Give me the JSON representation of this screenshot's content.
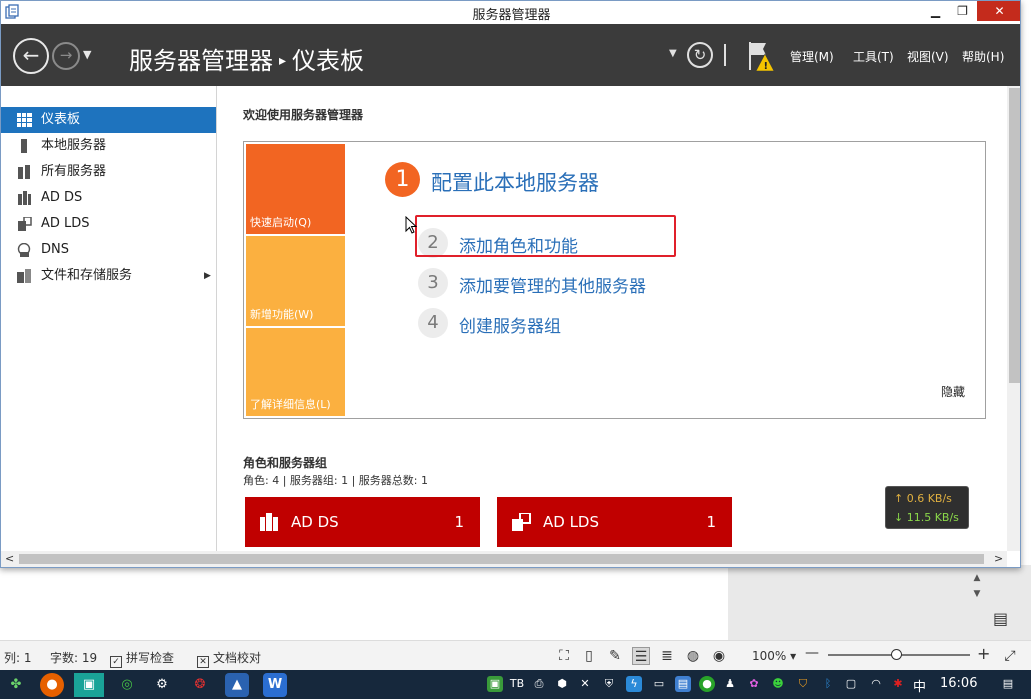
{
  "window": {
    "title": "服务器管理器"
  },
  "header": {
    "breadcrumb_root": "服务器管理器",
    "breadcrumb_sep": "▸",
    "breadcrumb_current": "仪表板",
    "menus": [
      "管理(M)",
      "工具(T)",
      "视图(V)",
      "帮助(H)"
    ]
  },
  "nav": {
    "items": [
      {
        "label": "仪表板",
        "icon": "dashboard-icon",
        "active": true
      },
      {
        "label": "本地服务器",
        "icon": "server-icon",
        "active": false
      },
      {
        "label": "所有服务器",
        "icon": "servers-icon",
        "active": false
      },
      {
        "label": "AD DS",
        "icon": "ad-ds-icon",
        "active": false
      },
      {
        "label": "AD LDS",
        "icon": "ad-lds-icon",
        "active": false
      },
      {
        "label": "DNS",
        "icon": "dns-icon",
        "active": false
      },
      {
        "label": "文件和存储服务",
        "icon": "file-storage-icon",
        "active": false,
        "has_arrow": true
      }
    ],
    "arrow": "▶"
  },
  "welcome": {
    "title": "欢迎使用服务器管理器",
    "tiles": [
      "快速启动(Q)",
      "新增功能(W)",
      "了解详细信息(L)"
    ],
    "step1": {
      "num": "1",
      "label": "配置此本地服务器"
    },
    "steps": [
      {
        "num": "2",
        "label": "添加角色和功能"
      },
      {
        "num": "3",
        "label": "添加要管理的其他服务器"
      },
      {
        "num": "4",
        "label": "创建服务器组"
      }
    ],
    "hide": "隐藏"
  },
  "roles": {
    "title": "角色和服务器组",
    "summary": "角色: 4 | 服务器组: 1 | 服务器总数: 1",
    "cards": [
      {
        "name": "AD DS",
        "count": "1"
      },
      {
        "name": "AD LDS",
        "count": "1"
      }
    ]
  },
  "network": {
    "up": "↑ 0.6 KB/s",
    "down": "↓ 11.5 KB/s"
  },
  "word_status": {
    "row": "列: 1",
    "char_count": "字数: 19",
    "spell_check": "拼写检查",
    "proofread": "文档校对",
    "zoom": "100%",
    "zoom_dd": "▾",
    "zoom_minus": "—",
    "zoom_plus": "+",
    "right_scroll_up": "▲",
    "right_scroll_down": "▼"
  },
  "taskbar": {
    "ime": "中",
    "clock": "16:06"
  },
  "colors": {
    "header_bg": "#3b3b3b",
    "nav_active": "#1e73be",
    "tile_orange": "#f26522",
    "tile_yellow": "#fbb040",
    "role_red": "#c00000",
    "link_blue": "#2a6fb8",
    "highlight": "#e0202a"
  }
}
